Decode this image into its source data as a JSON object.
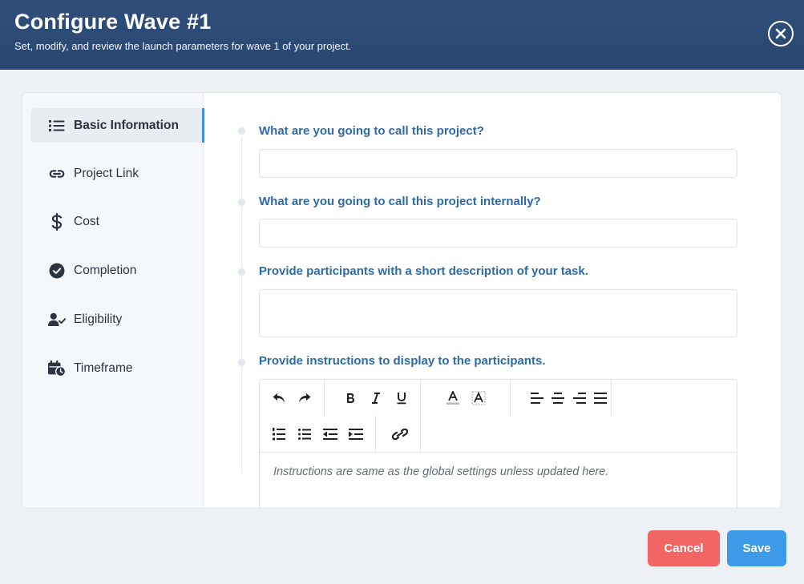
{
  "header": {
    "title": "Configure Wave #1",
    "subtitle": "Set, modify, and review the launch parameters for wave 1 of your project."
  },
  "sidebar": {
    "items": [
      {
        "label": "Basic Information",
        "icon": "list-icon",
        "active": true
      },
      {
        "label": "Project Link",
        "icon": "link-icon"
      },
      {
        "label": "Cost",
        "icon": "dollar-icon"
      },
      {
        "label": "Completion",
        "icon": "check-circle-icon"
      },
      {
        "label": "Eligibility",
        "icon": "user-check-icon"
      },
      {
        "label": "Timeframe",
        "icon": "calendar-clock-icon"
      }
    ]
  },
  "form": {
    "q1": {
      "label": "What are you going to call this project?",
      "value": ""
    },
    "q2": {
      "label": "What are you going to call this project internally?",
      "value": ""
    },
    "q3": {
      "label": "Provide participants with a short description of your task.",
      "value": ""
    },
    "q4": {
      "label": "Provide instructions to display to the participants.",
      "placeholder": "Instructions are same as the global settings unless updated here."
    }
  },
  "toolbar": {
    "tools": [
      "undo",
      "redo",
      "bold",
      "italic",
      "underline",
      "font-color",
      "highlight",
      "align-left",
      "align-center",
      "align-right",
      "justify",
      "ordered-list",
      "bullet-list",
      "outdent",
      "indent",
      "link"
    ]
  },
  "footer": {
    "cancel_label": "Cancel",
    "save_label": "Save"
  },
  "colors": {
    "header": "#2f4f7a",
    "accent": "#3a8fe0",
    "question": "#2e6aa8",
    "cancel": "#f16565",
    "save": "#3d9ae6"
  }
}
